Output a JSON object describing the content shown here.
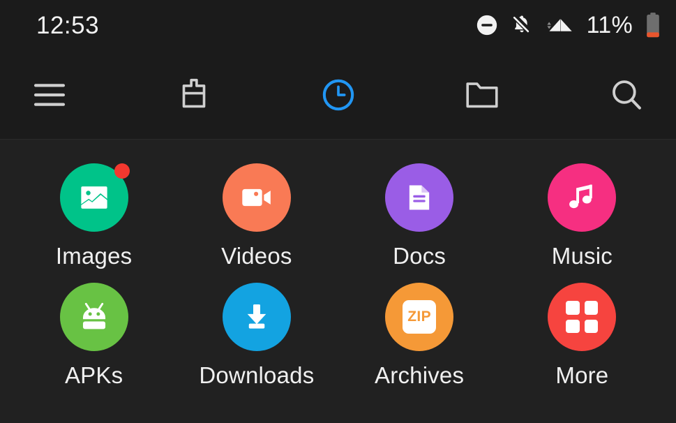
{
  "status_bar": {
    "time": "12:53",
    "battery_percent": "11%",
    "icons": [
      {
        "name": "do-not-disturb-icon",
        "label": "Do Not Disturb"
      },
      {
        "name": "notifications-off-icon",
        "label": "Notifications silenced"
      },
      {
        "name": "wifi-icon",
        "label": "Wi-Fi connected"
      },
      {
        "name": "battery-icon",
        "label": "Battery low"
      }
    ]
  },
  "toolbar": {
    "items": [
      {
        "name": "menu-button",
        "label": "Menu",
        "active": false
      },
      {
        "name": "cleaner-button",
        "label": "Cleaner",
        "active": false
      },
      {
        "name": "recents-button",
        "label": "Recents",
        "active": true
      },
      {
        "name": "folders-button",
        "label": "Folders",
        "active": false
      },
      {
        "name": "search-button",
        "label": "Search",
        "active": false
      }
    ],
    "active_color": "#2196f3",
    "inactive_color": "#c8c8c8"
  },
  "categories": [
    {
      "label": "Images",
      "icon": "image-icon",
      "color": "#00c389",
      "badge": true
    },
    {
      "label": "Videos",
      "icon": "video-icon",
      "color": "#f97a55",
      "badge": false
    },
    {
      "label": "Docs",
      "icon": "document-icon",
      "color": "#9a5de6",
      "badge": false
    },
    {
      "label": "Music",
      "icon": "music-note-icon",
      "color": "#f62f81",
      "badge": false
    },
    {
      "label": "APKs",
      "icon": "android-icon",
      "color": "#68c244",
      "badge": false
    },
    {
      "label": "Downloads",
      "icon": "download-icon",
      "color": "#13a3e1",
      "badge": false
    },
    {
      "label": "Archives",
      "icon": "zip-icon",
      "color": "#f59937",
      "badge": false,
      "chip_text": "ZIP"
    },
    {
      "label": "More",
      "icon": "grid-icon",
      "color": "#f6443f",
      "badge": false
    }
  ],
  "theme": {
    "background": "#212121",
    "bar_background": "#1b1b1b",
    "text_primary": "#f0f0f0",
    "badge_color": "#f4382f"
  }
}
